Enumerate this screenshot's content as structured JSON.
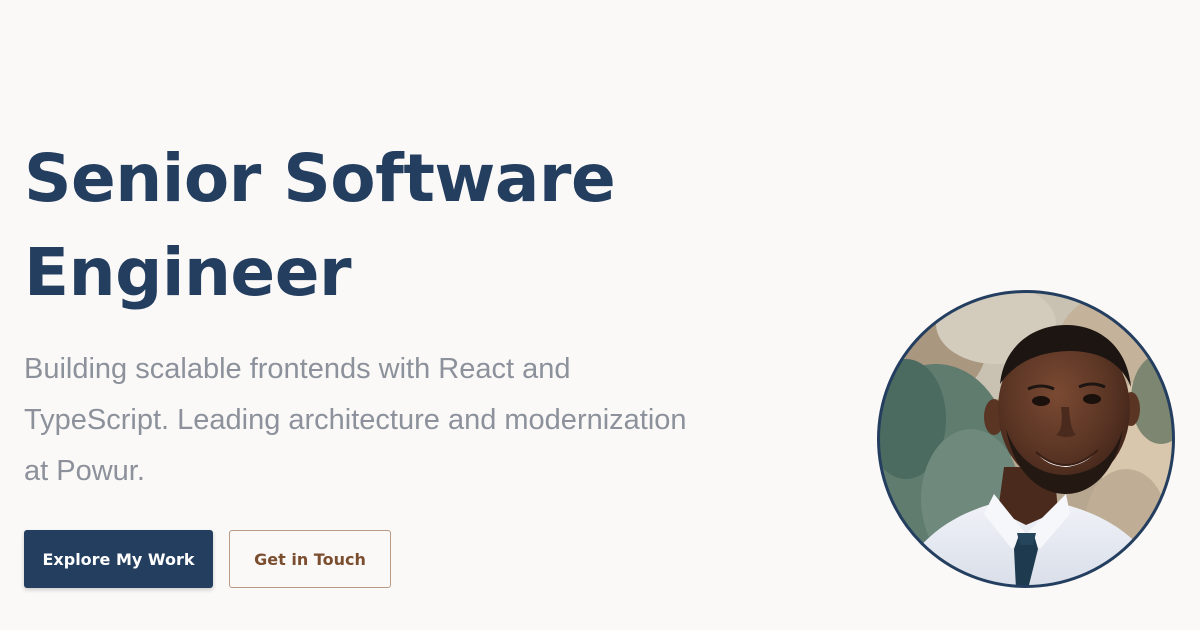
{
  "hero": {
    "headline_line1": "Senior Software",
    "headline_line2": "Engineer",
    "subtitle_line1": "Building scalable frontends with React and",
    "subtitle_line2": "TypeScript. Leading architecture and modernization",
    "subtitle_line3": "at Powur.",
    "primary_button_label": "Explore My Work",
    "secondary_button_label": "Get in Touch"
  },
  "avatar": {
    "icon": "profile-photo"
  },
  "colors": {
    "background": "#faf9f7",
    "navy": "#243e60",
    "muted_text": "#8c919b",
    "secondary_text": "#7a4e2f",
    "secondary_border": "#b99a86"
  }
}
